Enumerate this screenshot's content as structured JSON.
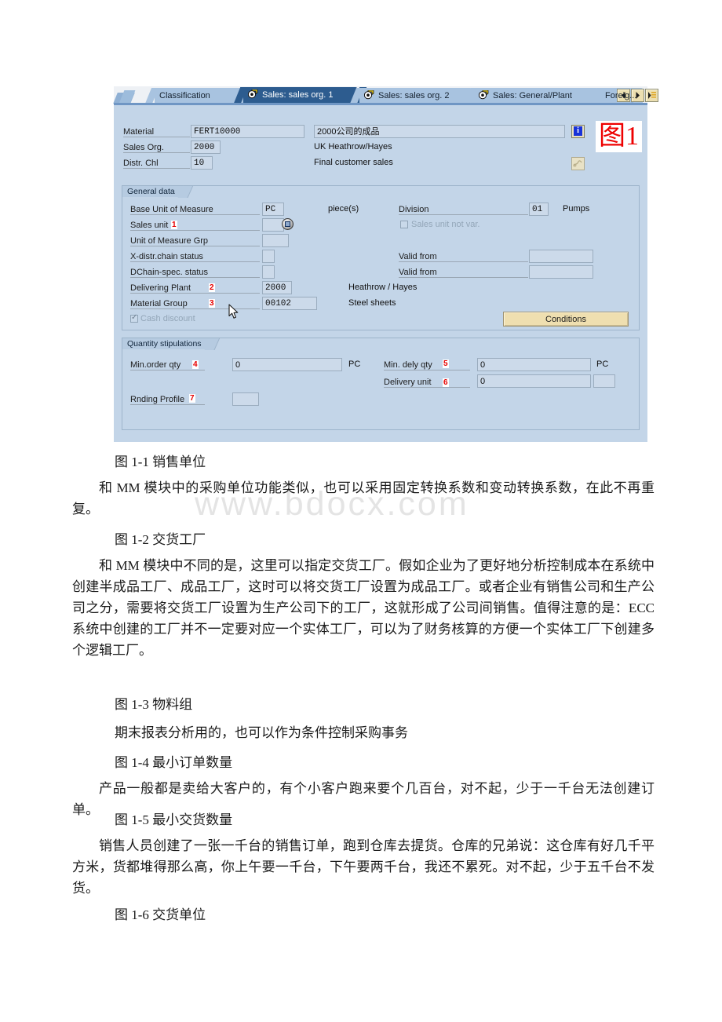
{
  "document": {
    "watermark": "www.bdocx.com",
    "blocks": [
      {
        "type": "caption",
        "text": "图 1-1 销售单位"
      },
      {
        "type": "paragraph",
        "text": "和 MM 模块中的采购单位功能类似，也可以采用固定转换系数和变动转换系数，在此不再重复。"
      },
      {
        "type": "caption",
        "text": "图 1-2 交货工厂"
      },
      {
        "type": "paragraph",
        "text": "和 MM 模块中不同的是，这里可以指定交货工厂。假如企业为了更好地分析控制成本在系统中创建半成品工厂、成品工厂，这时可以将交货工厂设置为成品工厂。或者企业有销售公司和生产公司之分，需要将交货工厂设置为生产公司下的工厂，这就形成了公司间销售。值得注意的是：ECC 系统中创建的工厂并不一定要对应一个实体工厂，可以为了财务核算的方便一个实体工厂下创建多个逻辑工厂。"
      },
      {
        "type": "caption",
        "text": "图 1-3 物料组"
      },
      {
        "type": "paragraph",
        "text": "期末报表分析用的，也可以作为条件控制采购事务"
      },
      {
        "type": "caption",
        "text": "图 1-4 最小订单数量"
      },
      {
        "type": "paragraph",
        "text": "产品一般都是卖给大客户的，有个小客户跑来要个几百台，对不起，少于一千台无法创建订单。"
      },
      {
        "type": "caption",
        "text": "图 1-5 最小交货数量"
      },
      {
        "type": "paragraph",
        "text": "销售人员创建了一张一千台的销售订单，跑到仓库去提货。仓库的兄弟说：这仓库有好几千平方米，货都堆得那么高，你上午要一千台，下午要两千台，我还不累死。对不起，少于五千台不发货。"
      },
      {
        "type": "caption",
        "text": "图 1-6 交货单位"
      }
    ]
  },
  "screenshot": {
    "annotation_tag": "图1",
    "tabs": [
      {
        "label": "Classification",
        "active": false,
        "has_icon": false
      },
      {
        "label": "Sales: sales org. 1",
        "active": true,
        "has_icon": true
      },
      {
        "label": "Sales: sales org. 2",
        "active": false,
        "has_icon": true
      },
      {
        "label": "Sales: General/Plant",
        "active": false,
        "has_icon": true
      },
      {
        "label": "Foreig...",
        "active": false,
        "has_icon": false
      }
    ],
    "tab_nav": [
      {
        "name": "scroll-left",
        "glyph": "◀"
      },
      {
        "name": "scroll-right",
        "glyph": "▶"
      },
      {
        "name": "tab-list",
        "glyph": "▤"
      }
    ],
    "header": {
      "material_label": "Material",
      "material_value": "FERT10000",
      "material_desc": "2000公司的成品",
      "sales_org_label": "Sales Org.",
      "sales_org_value": "2000",
      "sales_org_desc": "UK Heathrow/Hayes",
      "distr_chl_label": "Distr. Chl",
      "distr_chl_value": "10",
      "distr_chl_desc": "Final customer sales"
    },
    "general_data": {
      "title": "General data",
      "base_uom_label": "Base Unit of Measure",
      "base_uom_value": "PC",
      "base_uom_desc": "piece(s)",
      "division_label": "Division",
      "division_value": "01",
      "division_desc": "Pumps",
      "sales_unit_label": "Sales unit",
      "sales_unit_value": "",
      "sales_unit_num": "1",
      "sales_unit_not_var_label": "Sales unit not var.",
      "uom_grp_label": "Unit of Measure Grp",
      "uom_grp_value": "",
      "xdistr_label": "X-distr.chain status",
      "xdistr_value": "",
      "valid_from_1_label": "Valid from",
      "valid_from_1_value": "",
      "dchain_label": "DChain-spec. status",
      "dchain_value": "",
      "valid_from_2_label": "Valid from",
      "valid_from_2_value": "",
      "plant_label": "Delivering Plant",
      "plant_num": "2",
      "plant_value": "2000",
      "plant_desc": "Heathrow / Hayes",
      "matgrp_label": "Material Group",
      "matgrp_num": "3",
      "matgrp_value": "00102",
      "matgrp_desc": "Steel sheets",
      "cash_discount_label": "Cash discount",
      "conditions_button": "Conditions"
    },
    "quantity_stipulations": {
      "title": "Quantity stipulations",
      "min_order_label": "Min.order qty",
      "min_order_num": "4",
      "min_order_value": "0",
      "min_order_uom": "PC",
      "min_dely_label": "Min. dely qty",
      "min_dely_num": "5",
      "min_dely_value": "0",
      "min_dely_uom": "PC",
      "delivery_unit_label": "Delivery unit",
      "delivery_unit_num": "6",
      "delivery_unit_value": "0",
      "delivery_unit_uom": "",
      "rnding_label": "Rnding Profile",
      "rnding_num": "7",
      "rnding_value": ""
    }
  }
}
